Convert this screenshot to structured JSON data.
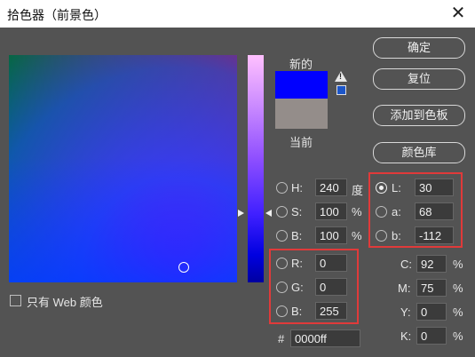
{
  "title": "拾色器（前景色）",
  "close_icon": "close-icon",
  "labels": {
    "new": "新的",
    "current": "当前"
  },
  "swatch_colors": {
    "new": "#0000ff",
    "current": "#948d8a"
  },
  "buttons": {
    "ok": "确定",
    "reset": "复位",
    "add_to_swatches": "添加到色板",
    "color_libraries": "颜色库"
  },
  "hsb": {
    "h": {
      "label": "H:",
      "value": "240",
      "unit": "度"
    },
    "s": {
      "label": "S:",
      "value": "100",
      "unit": "%"
    },
    "b": {
      "label": "B:",
      "value": "100",
      "unit": "%"
    }
  },
  "rgb": {
    "r": {
      "label": "R:",
      "value": "0"
    },
    "g": {
      "label": "G:",
      "value": "0"
    },
    "b": {
      "label": "B:",
      "value": "255"
    }
  },
  "lab": {
    "l": {
      "label": "L:",
      "value": "30"
    },
    "a": {
      "label": "a:",
      "value": "68"
    },
    "b": {
      "label": "b:",
      "value": "-112"
    }
  },
  "cmyk": {
    "c": {
      "label": "C:",
      "value": "92",
      "unit": "%"
    },
    "m": {
      "label": "M:",
      "value": "75",
      "unit": "%"
    },
    "y": {
      "label": "Y:",
      "value": "0",
      "unit": "%"
    },
    "k": {
      "label": "K:",
      "value": "0",
      "unit": "%"
    }
  },
  "hex": {
    "label": "#",
    "value": "0000ff"
  },
  "only_web_colors": "只有 Web 颜色",
  "highlight_color": "#e03a3a"
}
